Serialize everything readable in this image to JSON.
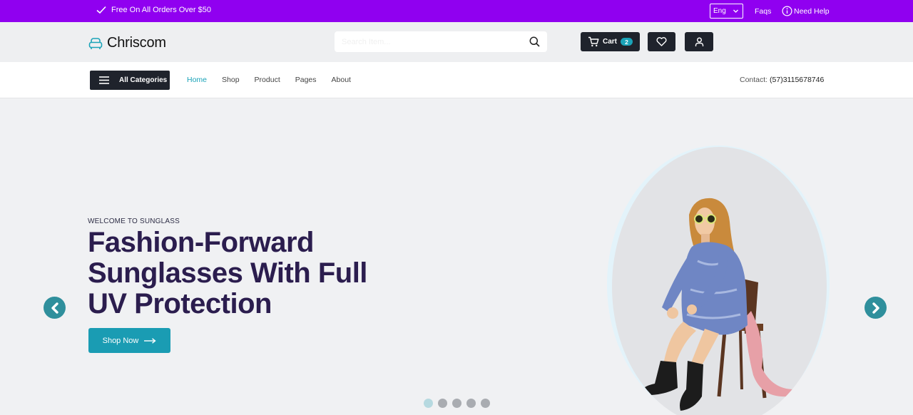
{
  "topbar": {
    "promo": "Free On All Orders Over $50",
    "language": "Eng",
    "faqs": "Faqs",
    "help": "Need Help"
  },
  "header": {
    "brand": "Chriscom",
    "search_placeholder": "Search Item...",
    "cart_label": "Cart",
    "cart_count": "2"
  },
  "nav": {
    "categories_label": "All Categories",
    "items": [
      "Home",
      "Shop",
      "Product",
      "Pages",
      "About"
    ],
    "active_item": "Home",
    "contact_label": "Contact:",
    "contact_number": "(57)3115678746"
  },
  "hero": {
    "eyebrow": "WELCOME TO SUNGLASS",
    "headline": "Fashion-Forward Sunglasses With Full UV Protection",
    "cta": "Shop Now",
    "slide_count": 5,
    "active_slide": 1
  },
  "colors": {
    "topbar": "#9000f0",
    "accent": "#1aa3b8",
    "dark": "#1f232c",
    "headline": "#2b1d4e"
  },
  "icons": [
    "check-icon",
    "chevron-down-icon",
    "info-icon",
    "sofa-logo-icon",
    "search-icon",
    "cart-icon",
    "heart-icon",
    "user-icon",
    "menu-icon",
    "arrow-right-icon",
    "chevron-left-icon",
    "chevron-right-icon"
  ]
}
